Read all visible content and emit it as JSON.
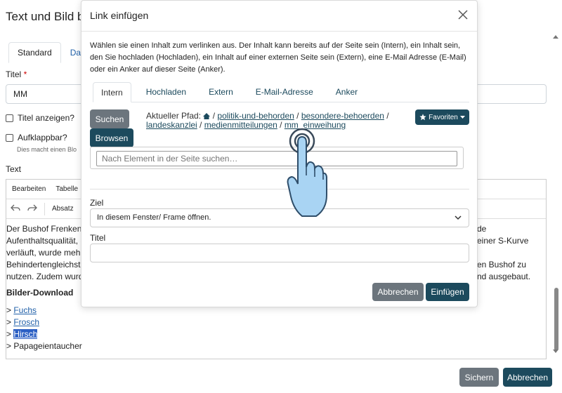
{
  "page": {
    "title": "Text und Bild b",
    "tabs": [
      "Standard",
      "Dar"
    ],
    "title_label": "Titel",
    "title_required": "*",
    "title_value": "MM",
    "show_title_label": "Titel anzeigen?",
    "collapsible_label": "Aufklappbar?",
    "collapsible_hint": "Dies macht einen Blo",
    "text_label": "Text",
    "editor_menu": [
      "Bearbeiten",
      "Tabelle"
    ],
    "editor_block_format": "Absatz",
    "editor_lines": [
      {
        "left": "Der Bushof Frenkendo",
        "right": "de"
      },
      {
        "left": "Aufenthaltsqualität, S",
        "right": "einer S-Kurve"
      },
      {
        "left": "verläuft, wurde mehr P",
        "right": ""
      },
      {
        "left": "Behindertengleichstel",
        "right": "en Bushof zu"
      },
      {
        "left": "nutzen. Zudem wurde",
        "right": "nd ausgebaut."
      }
    ],
    "editor_heading": "Bilder-Download",
    "downloads": [
      {
        "prefix": "> ",
        "label": "Fuchs"
      },
      {
        "prefix": "> ",
        "label": "Frosch"
      },
      {
        "prefix": "> ",
        "label": "Hirsch"
      },
      {
        "prefix": "> ",
        "label": "Papageientaucher"
      }
    ],
    "save_label": "Sichern",
    "cancel_label": "Abbrechen"
  },
  "modal": {
    "title": "Link einfügen",
    "description": "Wählen sie einen Inhalt zum verlinken aus. Der Inhalt kann bereits auf der Seite sein (Intern), ein Inhalt sein, den Sie hochladen (Hochladen), ein Inhalt auf einer externen Seite sein (Extern), eine E-Mail Adresse (E-Mail) oder ein Anker auf dieser Seite (Anker).",
    "tabs": [
      "Intern",
      "Hochladen",
      "Extern",
      "E-Mail-Adresse",
      "Anker"
    ],
    "search_button": "Suchen",
    "browse_button": "Browsen",
    "path_label": "Aktueller Pfad:",
    "path": [
      "politik-und-behorden",
      "besondere-behoerden",
      "landeskanzlei",
      "medienmitteilungen",
      "mm_einweihung"
    ],
    "favorites_label": "Favoriten",
    "search_placeholder": "Nach Element in der Seite suchen…",
    "target_label": "Ziel",
    "target_value": "In diesem Fenster/ Frame öffnen.",
    "title_label": "Titel",
    "cancel_label": "Abbrechen",
    "insert_label": "Einfügen"
  },
  "colors": {
    "primary_dark": "#1c4a5d",
    "secondary": "#6c757d",
    "link": "#1f5fa8",
    "selection": "#2b5fc4"
  },
  "icons": [
    "home-icon",
    "star-icon",
    "caret-down-icon",
    "close-icon",
    "chevron-down-icon",
    "undo-icon",
    "redo-icon",
    "pointer-hand-icon"
  ]
}
